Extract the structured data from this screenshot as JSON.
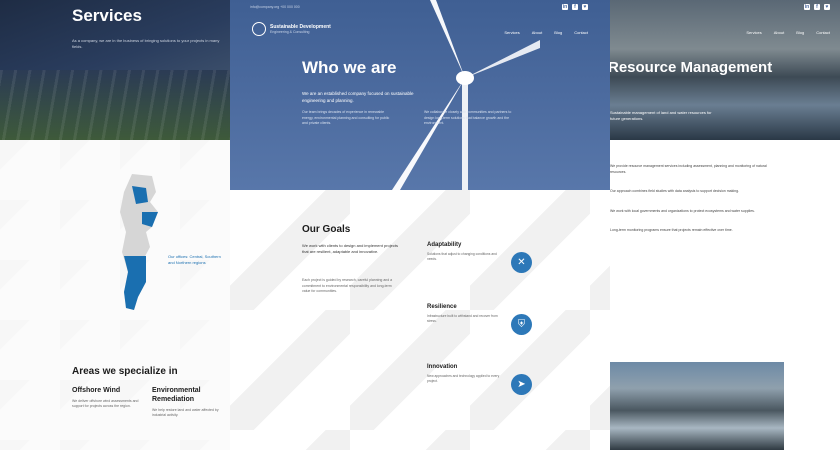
{
  "left": {
    "title": "Services",
    "hero_text": "As a company, we are in the business of bringing solutions to your projects in many fields.",
    "map_label": "Our offices: Central, Southern and Northern regions",
    "areas_title": "Areas we specialize in",
    "areas": [
      {
        "title": "Offshore Wind",
        "text": "We deliver offshore wind assessments and support for projects across the region."
      },
      {
        "title": "Environmental Remediation",
        "text": "We help restore land and water affected by industrial activity."
      }
    ]
  },
  "center": {
    "topbar": "info@company.org   +00 000 000",
    "logo_name": "Sustainable Development",
    "logo_sub": "Engineering & Consulting",
    "nav": [
      "Services",
      "About",
      "Blog",
      "Contact"
    ],
    "title": "Who we are",
    "lead": "We are an established company focused on sustainable engineering and planning.",
    "col1": "Our team brings decades of experience in renewable energy, environmental planning and consulting for public and private clients.",
    "col2": "We collaborate closely with communities and partners to design long-term solutions that balance growth and the environment.",
    "goals_title": "Our Goals",
    "goals_lead": "We work with clients to design and implement projects that are resilient, adaptable and innovative.",
    "goals_body": "Each project is guided by research, careful planning and a commitment to environmental responsibility and long-term value for communities.",
    "goals": [
      {
        "title": "Adaptability",
        "text": "Solutions that adjust to changing conditions and needs.",
        "icon": "tools-icon"
      },
      {
        "title": "Resilience",
        "text": "Infrastructure built to withstand and recover from stress.",
        "icon": "shield-icon"
      },
      {
        "title": "Innovation",
        "text": "New approaches and technology applied to every project.",
        "icon": "send-icon"
      }
    ]
  },
  "right": {
    "title": "Resource Management",
    "lead": "Sustainable management of land and water resources for future generations.",
    "nav": [
      "Services",
      "About",
      "Blog",
      "Contact"
    ],
    "paragraphs": [
      "We provide resource management services including assessment, planning and monitoring of natural resources.",
      "Our approach combines field studies with data analysis to support decision making.",
      "We work with local governments and organizations to protect ecosystems and water supplies.",
      "Long-term monitoring programs ensure that projects remain effective over time."
    ]
  },
  "colors": {
    "accent": "#2d78b8",
    "hero_blue": "#4d6ca0"
  }
}
